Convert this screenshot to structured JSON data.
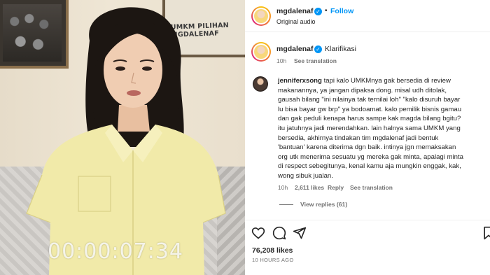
{
  "video": {
    "poster_text": "UMKM PILIHAN MGDALENAF",
    "timecode": "00:00:07:34"
  },
  "post_header": {
    "username": "mgdalenaf",
    "verified": true,
    "separator": "•",
    "follow_label": "Follow",
    "audio": "Original audio"
  },
  "caption": {
    "username": "mgdalenaf",
    "text": "Klarifikasi",
    "age": "10h",
    "see_translation": "See translation"
  },
  "comment": {
    "username": "jenniferxsong",
    "lines": [
      "tapi kalo UMKMnya gak bersedia di review",
      "makanannya, ya jangan dipaksa dong. misal udh ditolak,",
      "gausah bilang \"ini nilainya tak ternilai loh\" \"kalo disuruh bayar",
      "lu bisa bayar gw brp\" ya bodoamat. kalo pemilik bisnis gamau",
      "dan gak peduli kenapa harus sampe kak magda bilang bgitu?",
      "itu jatuhnya jadi merendahkan. lain halnya sama UMKM yang",
      "bersedia, akhirnya tindakan tim mgdalenaf jadi bentuk",
      "'bantuan' karena diterima dgn baik. intinya jgn memaksakan",
      "org utk menerima sesuatu yg mereka gak minta, apalagi minta",
      "di respect sebegitunya, kenal kamu aja mungkin enggak, kak,",
      "wong sibuk jualan."
    ],
    "age": "10h",
    "likes": "2,611 likes",
    "reply": "Reply",
    "see_translation": "See translation",
    "view_replies": "View replies (61)"
  },
  "actions": {
    "like_icon": "heart-icon",
    "comment_icon": "comment-icon",
    "share_icon": "share-icon",
    "save_icon": "bookmark-icon"
  },
  "footer": {
    "likes": "76,208 likes",
    "time_ago": "10 HOURS AGO"
  },
  "colors": {
    "accent": "#0095f6",
    "text": "#262626",
    "muted": "#737373",
    "shirt": "#f1eaa9"
  }
}
